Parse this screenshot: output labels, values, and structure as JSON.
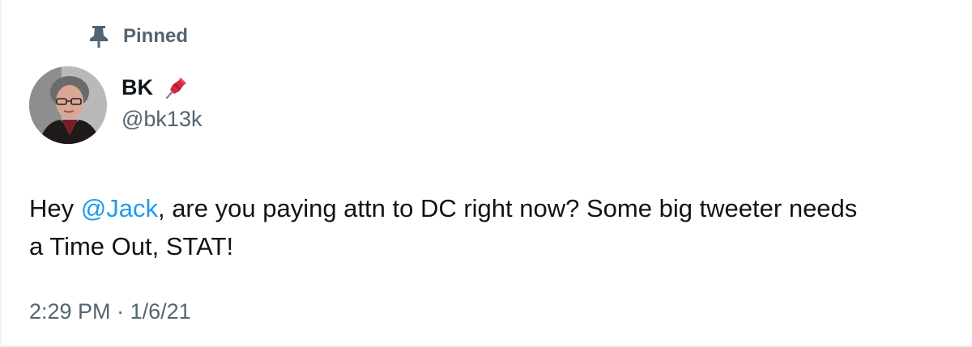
{
  "pinned": {
    "label": "Pinned",
    "icon": "pin-icon"
  },
  "author": {
    "name": "BK",
    "name_emoji": "pushpin-emoji-icon",
    "handle": "@bk13k",
    "avatar": "avatar"
  },
  "tweet": {
    "text_part1": "Hey ",
    "mention": "@Jack",
    "text_part2": ", are you paying attn to DC right now? Some big tweeter needs",
    "text_part3": "a Time Out, STAT!",
    "time": "2:29 PM",
    "separator": " · ",
    "date": "1/6/21"
  },
  "colors": {
    "text": "#0f1419",
    "secondary": "#536471",
    "link": "#1d9bf0",
    "border": "#eff3f4"
  }
}
